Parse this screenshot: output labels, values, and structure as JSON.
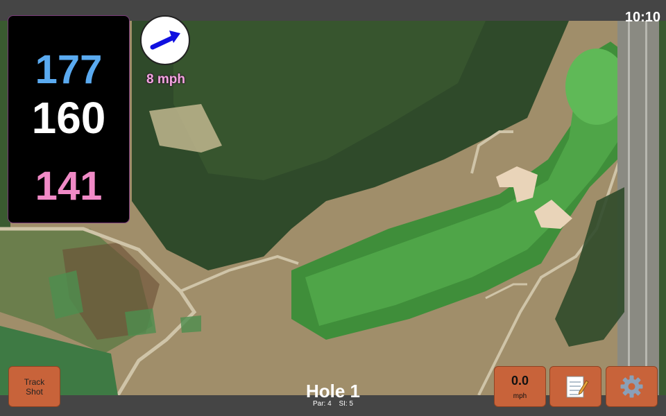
{
  "status": {
    "time": "10:10"
  },
  "yardages": {
    "back": "177",
    "middle": "160",
    "front": "141"
  },
  "wind": {
    "speed": "8 mph",
    "direction_icon": "wind-arrow-icon"
  },
  "buttons": {
    "track_shot": "Track\nShot",
    "speed_value": "0.0",
    "speed_unit": "mph",
    "notes_icon": "notepad-icon",
    "settings_icon": "gear-icon"
  },
  "hole": {
    "title": "Hole 1",
    "par": "Par: 4",
    "si": "SI: 5"
  },
  "colors": {
    "back": "#5aaaf0",
    "middle": "#ffffff",
    "front": "#f08ac6",
    "button": "#c8633a",
    "wind_text": "#f3a6e0"
  }
}
